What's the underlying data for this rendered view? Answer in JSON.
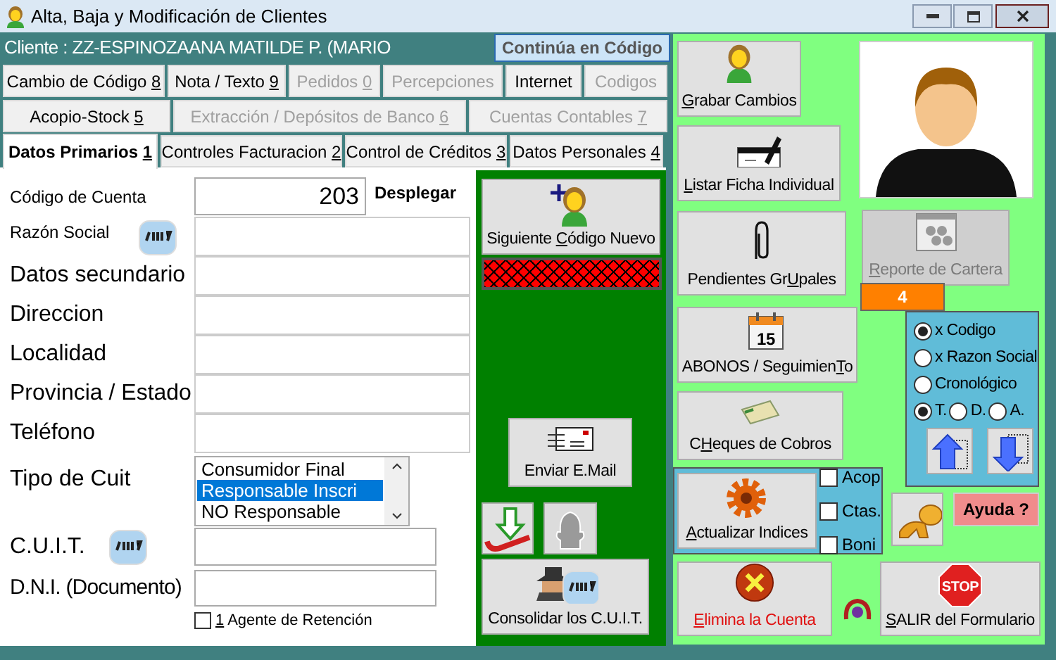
{
  "window": {
    "title": "Alta, Baja y Modificación de Clientes"
  },
  "client_bar": {
    "text": "Cliente : ZZ-ESPINOZAANA MATILDE P. (MARIO",
    "continue_button": "Continúa en Código"
  },
  "tab_rows": [
    [
      {
        "pre": "Cambio de Código ",
        "key": "8",
        "disabled": false,
        "selected": false
      },
      {
        "pre": "Nota / Texto ",
        "key": "9",
        "disabled": false,
        "selected": false
      },
      {
        "pre": "Pedidos ",
        "key": "0",
        "disabled": true,
        "selected": false
      },
      {
        "pre": "Percepciones",
        "disabled": true,
        "selected": false
      },
      {
        "pre": "Internet",
        "disabled": false,
        "selected": false
      },
      {
        "pre": "Codigos",
        "disabled": true,
        "selected": false
      }
    ],
    [
      {
        "pre": "Acopio-Stock ",
        "key": "5",
        "disabled": false,
        "selected": false
      },
      {
        "pre": "Extracción / Depósitos de Banco ",
        "key": "6",
        "disabled": true,
        "selected": false
      },
      {
        "pre": "Cuentas Contables ",
        "key": "7",
        "disabled": true,
        "selected": false
      }
    ],
    [
      {
        "pre": "Datos Primarios ",
        "key": "1",
        "disabled": false,
        "selected": true
      },
      {
        "pre": "Controles Facturacion ",
        "key": "2",
        "disabled": false,
        "selected": false
      },
      {
        "pre": "Control de Créditos ",
        "key": "3",
        "disabled": false,
        "selected": false
      },
      {
        "pre": "Datos Personales ",
        "key": "4",
        "disabled": false,
        "selected": false
      }
    ]
  ],
  "form": {
    "account_code": {
      "label": "Código de Cuenta",
      "value": "203",
      "action": "Desplegar"
    },
    "text_rows": [
      {
        "label": "Razón Social",
        "kind": "lookup"
      },
      {
        "label": "Datos secundario",
        "kind": "plain"
      },
      {
        "label": "Direccion",
        "kind": "plain"
      },
      {
        "label": "Localidad",
        "kind": "plain"
      },
      {
        "label": "Provincia / Estado",
        "kind": "plain"
      },
      {
        "label": "Teléfono",
        "kind": "plain"
      }
    ],
    "cuit_type": {
      "label": "Tipo de Cuit",
      "options": [
        {
          "text": "Consumidor Final",
          "selected": false
        },
        {
          "text": "Responsable Inscri",
          "selected": true
        },
        {
          "text": "NO Responsable",
          "selected": false
        }
      ]
    },
    "cuit": {
      "label": "C.U.I.T."
    },
    "dni": {
      "label": "D.N.I. (Documento)"
    },
    "retention_agent": {
      "key": "1",
      "post": " Agente de Retención",
      "checked": false
    }
  },
  "actions": {
    "next_code": {
      "pre": "Siguiente ",
      "key": "C",
      "post": "ódigo Nuevo"
    },
    "send_email": {
      "pre": "Enviar E.Mail"
    },
    "consolidate": {
      "pre": "Consolidar los C.U.I.T."
    }
  },
  "side": {
    "save": {
      "key": "G",
      "post": "rabar Cambios"
    },
    "print_card": {
      "key": "L",
      "post": "istar Ficha Individual"
    },
    "pending": {
      "pre": "Pendientes Gr",
      "key": "U",
      "post": "pales"
    },
    "portfolio_report": {
      "key": "R",
      "post": "eporte de Cartera",
      "disabled": true
    },
    "count": "4",
    "payments": {
      "pre": "ABONOS / Seguimien",
      "key": "T",
      "post": "o",
      "calendar_day": "15"
    },
    "checks": {
      "pre": "C",
      "key": "H",
      "post": "eques de Cobros"
    },
    "update_indexes": {
      "key": "A",
      "post": "ctualizar Indices",
      "options": [
        {
          "label": "Acop",
          "checked": false
        },
        {
          "label": "Ctas.",
          "checked": false
        },
        {
          "label": "Boni",
          "checked": false
        }
      ]
    },
    "sort": {
      "options": [
        {
          "label": "x Codigo",
          "selected": true
        },
        {
          "label": "x Razon Social",
          "selected": false
        },
        {
          "label": "Cronológico",
          "selected": false
        }
      ],
      "scope": [
        {
          "label": "T.",
          "selected": true
        },
        {
          "label": "D.",
          "selected": false
        },
        {
          "label": "A.",
          "selected": false
        }
      ]
    },
    "help": "Ayuda ?",
    "delete": {
      "key": "E",
      "post": "limina la Cuenta"
    },
    "exit": {
      "key": "S",
      "post": "ALIR del Formulario",
      "sign": "STOP"
    }
  }
}
